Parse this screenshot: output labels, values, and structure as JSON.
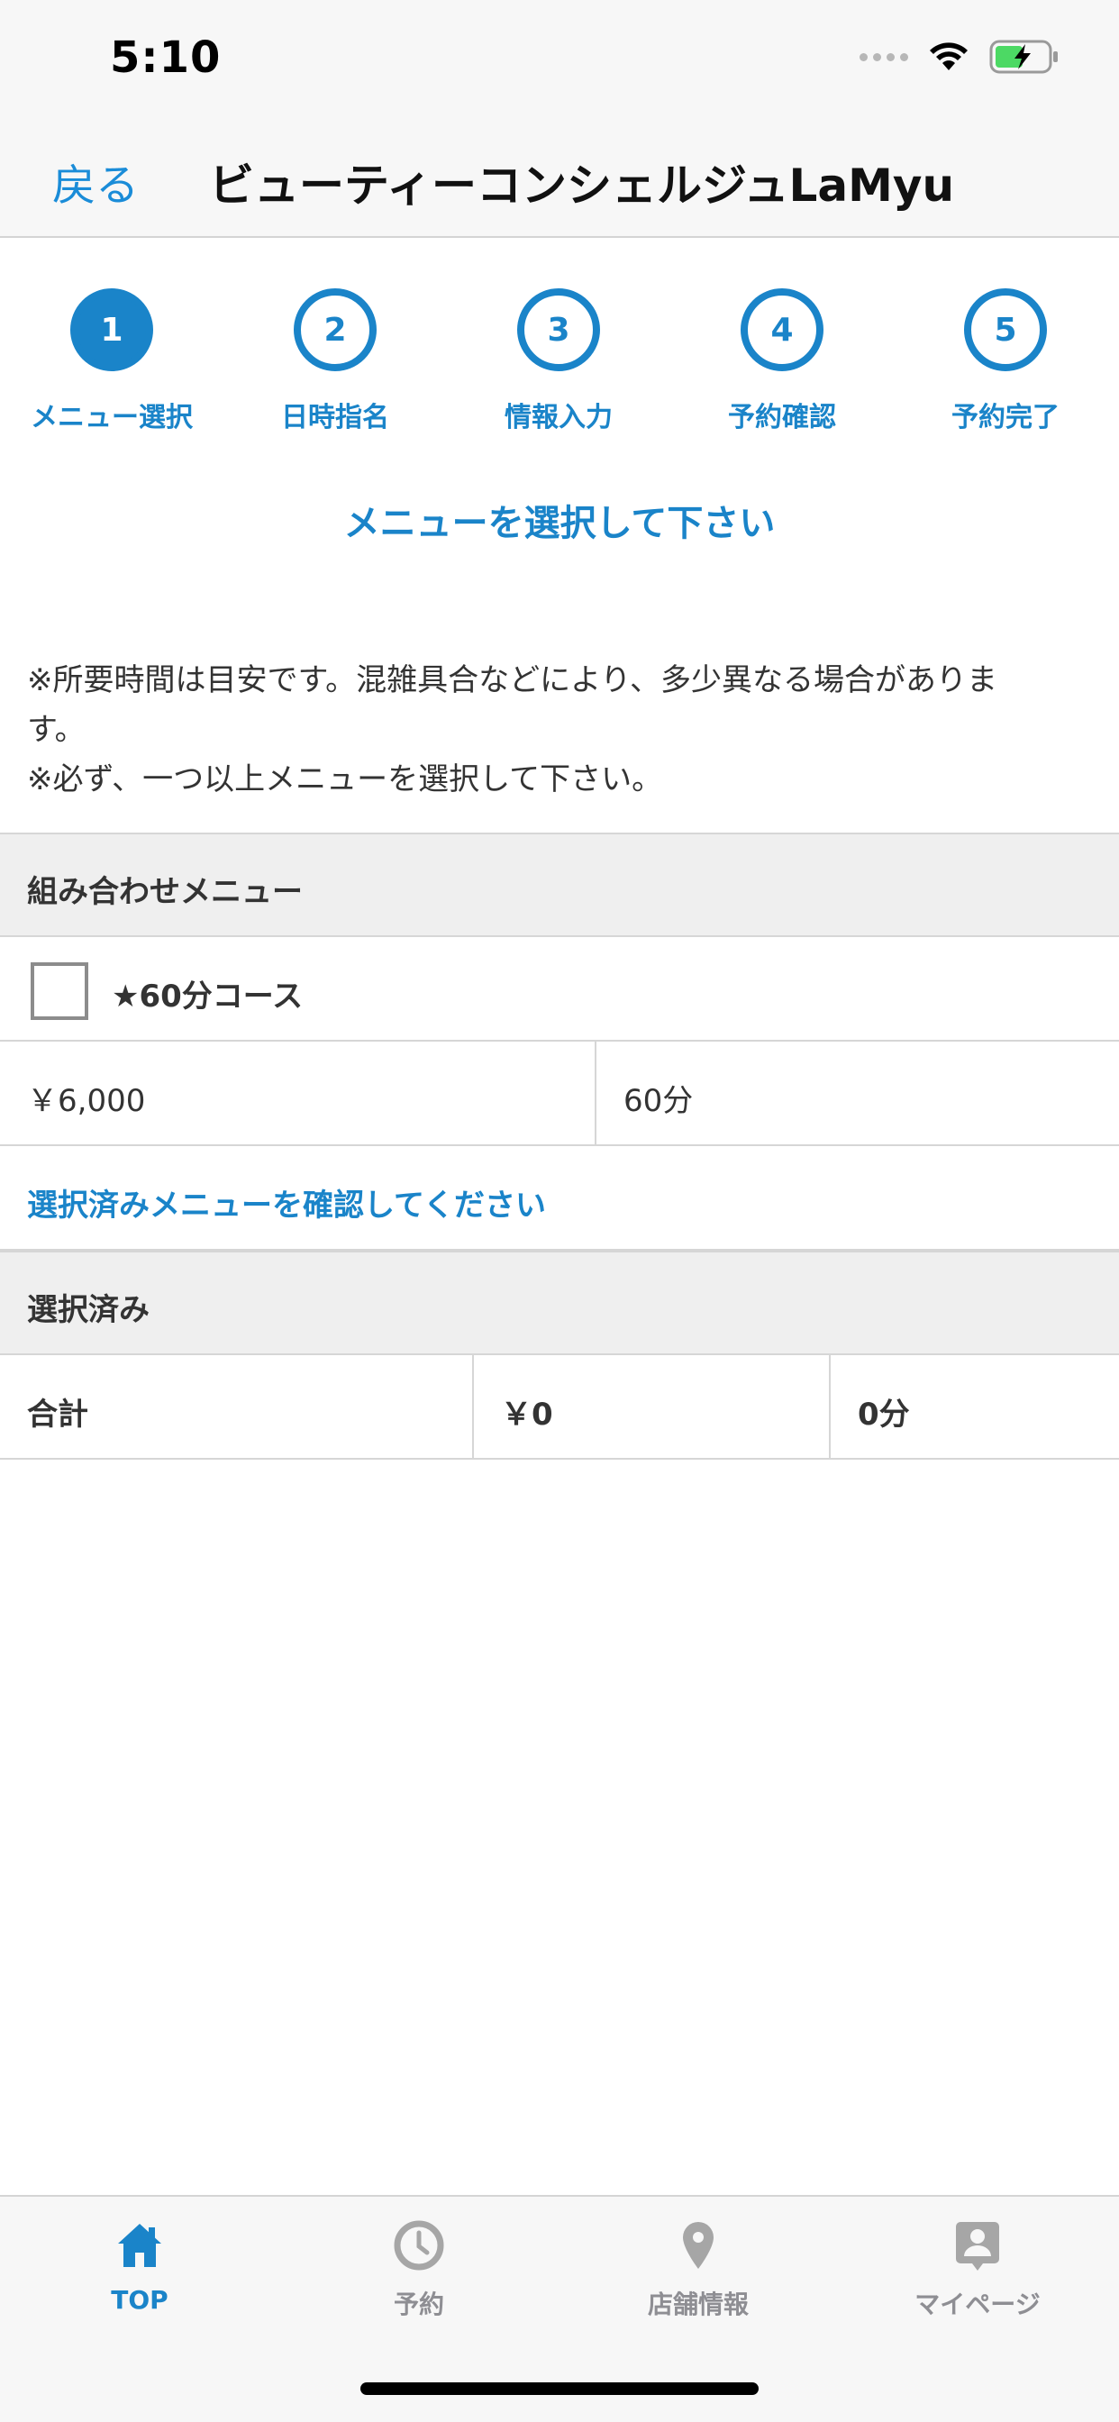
{
  "status_bar": {
    "time": "5:10"
  },
  "nav": {
    "back_label": "戻る",
    "title": "ビューティーコンシェルジュLaMyu"
  },
  "steps": [
    {
      "number": "1",
      "label": "メニュー選択",
      "active": true
    },
    {
      "number": "2",
      "label": "日時指名",
      "active": false
    },
    {
      "number": "3",
      "label": "情報入力",
      "active": false
    },
    {
      "number": "4",
      "label": "予約確認",
      "active": false
    },
    {
      "number": "5",
      "label": "予約完了",
      "active": false
    }
  ],
  "instruction": "メニューを選択して下さい",
  "notes": {
    "line1": "※所要時間は目安です。混雑具合などにより、多少異なる場合がありま",
    "line2": "す。",
    "line3": "※必ず、一つ以上メニューを選択して下さい。"
  },
  "combo_section": {
    "header": "組み合わせメニュー",
    "course": {
      "label": "★60分コース",
      "checked": false,
      "price": "￥6,000",
      "duration": "60分"
    }
  },
  "confirm_link": "選択済みメニューを確認してください",
  "selected_section": {
    "header": "選択済み",
    "total_label": "合計",
    "total_price": "￥0",
    "total_duration": "0分"
  },
  "tabs": [
    {
      "label": "TOP",
      "icon": "home-icon",
      "active": true
    },
    {
      "label": "予約",
      "icon": "clock-icon",
      "active": false
    },
    {
      "label": "店舗情報",
      "icon": "location-pin-icon",
      "active": false
    },
    {
      "label": "マイページ",
      "icon": "profile-icon",
      "active": false
    }
  ],
  "colors": {
    "accent": "#1a84c9",
    "inactive_tab": "#8e8e93",
    "section_bg": "#efefef"
  }
}
